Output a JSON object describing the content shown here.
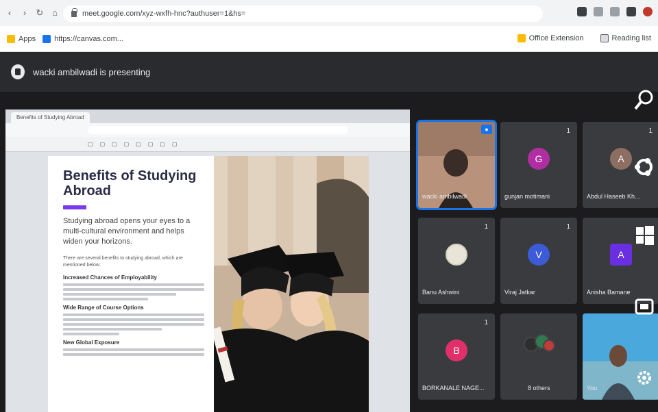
{
  "browser": {
    "url": "meet.google.com/xyz-wxfh-hnc?authuser=1&hs=",
    "bookmarks": [
      {
        "label": "Apps",
        "color": "#fbbc04"
      },
      {
        "label": "https://canvas.com...",
        "color": "#1a73e8"
      }
    ],
    "bookmarks_right": [
      "Office Extension",
      "Reading list"
    ]
  },
  "meeting": {
    "banner_text": "wacki ambilwadi is presenting"
  },
  "shared": {
    "tab_label": "Benefits of Studying Abroad",
    "doc_title": "Benefits of Studying Abroad",
    "lead": "Studying abroad opens your eyes to a multi-cultural environment and helps widen your horizons.",
    "intro_small": "There are several benefits to studying abroad, which are mentioned below:",
    "section1": "Increased Chances of Employability",
    "section2": "Wide Range of Course Options",
    "section3": "New Global Exposure"
  },
  "participants": [
    {
      "name": "wacki ambilwadi",
      "avatar": "",
      "color": "#c67a4a",
      "pinned": true,
      "video": true
    },
    {
      "name": "gunjan motimani",
      "avatar": "G",
      "color": "#b02ea1",
      "mic": "1"
    },
    {
      "name": "Abdul Haseeb Kh...",
      "avatar": "A",
      "color": "#8d6e63",
      "mic": "1"
    },
    {
      "name": "Banu Ashwini",
      "avatar": "",
      "color": "#e8e4d8",
      "mic": "1"
    },
    {
      "name": "Viraj Jatkar",
      "avatar": "V",
      "color": "#3b5cd6",
      "mic": "1"
    },
    {
      "name": "Anisha Bamane",
      "avatar": "A",
      "color": "#6a2fe0",
      "mic": ""
    },
    {
      "name": "BORKANALE NAGE...",
      "avatar": "B",
      "color": "#e0306a",
      "mic": "1"
    },
    {
      "name": "8 others",
      "avatar": "",
      "color": "#3a3b3f",
      "mic": ""
    },
    {
      "name": "You",
      "avatar": "",
      "color": "#3aa0d8",
      "video": true
    }
  ],
  "sidebar_icons": [
    "search-icon",
    "ubuntu-icon",
    "windows-icon",
    "present-icon",
    "settings-icon"
  ]
}
